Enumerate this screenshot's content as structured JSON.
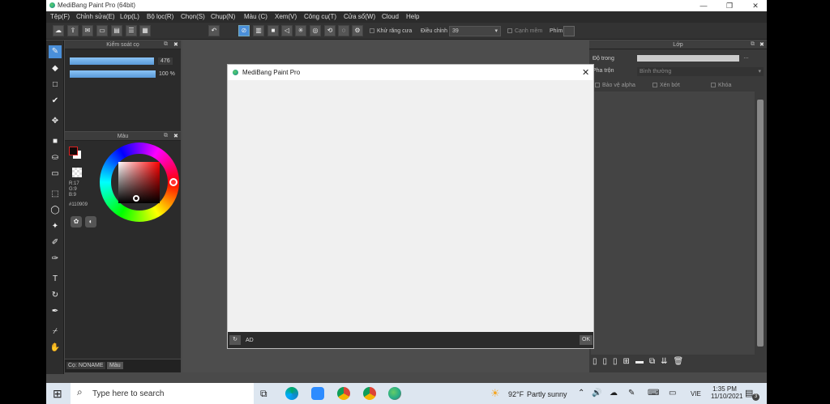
{
  "window": {
    "title": "MediBang Paint Pro (64bit)"
  },
  "menu": [
    "Tệp(F)",
    "Chỉnh sửa(E)",
    "Lớp(L)",
    "Bộ lọc(R)",
    "Chọn(S)",
    "Chụp(N)",
    "Màu (C)",
    "Xem(V)",
    "Công cụ(T)",
    "Cửa sổ(W)",
    "Cloud",
    "Help"
  ],
  "toolbar": {
    "antialias_label": "Khử răng cưa",
    "correction_label": "Điều chỉnh",
    "correction_value": "39",
    "soft_edge_label": "Cạnh mềm",
    "keys_label": "Phím"
  },
  "brush_panel": {
    "title": "Kiểm soát cọ",
    "size_value": "476",
    "opacity_value": "100 %"
  },
  "color_panel": {
    "title": "Màu",
    "r": "R:17",
    "g": "G:9",
    "b": "B:9",
    "hex": "#110909",
    "color": "#110909"
  },
  "brush_footer": {
    "tab1": "Cọ: NONAME",
    "tab2": "Màu"
  },
  "layer_panel": {
    "title": "Lớp",
    "opacity_label": "Độ trong",
    "blend_label": "Pha trộn",
    "blend_value": "Bình thường",
    "protect_alpha": "Bảo vệ alpha",
    "clipping": "Xén bớt",
    "lock": "Khóa"
  },
  "dialog": {
    "title": "MediBang Paint Pro",
    "footer_text": "AD",
    "ok_label": "OK"
  },
  "taskbar": {
    "search_placeholder": "Type here to search",
    "weather_temp": "92°F",
    "weather_desc": "Partly sunny",
    "lang": "VIE",
    "time": "1:35 PM",
    "date": "11/10/2021",
    "notif_count": "3"
  }
}
